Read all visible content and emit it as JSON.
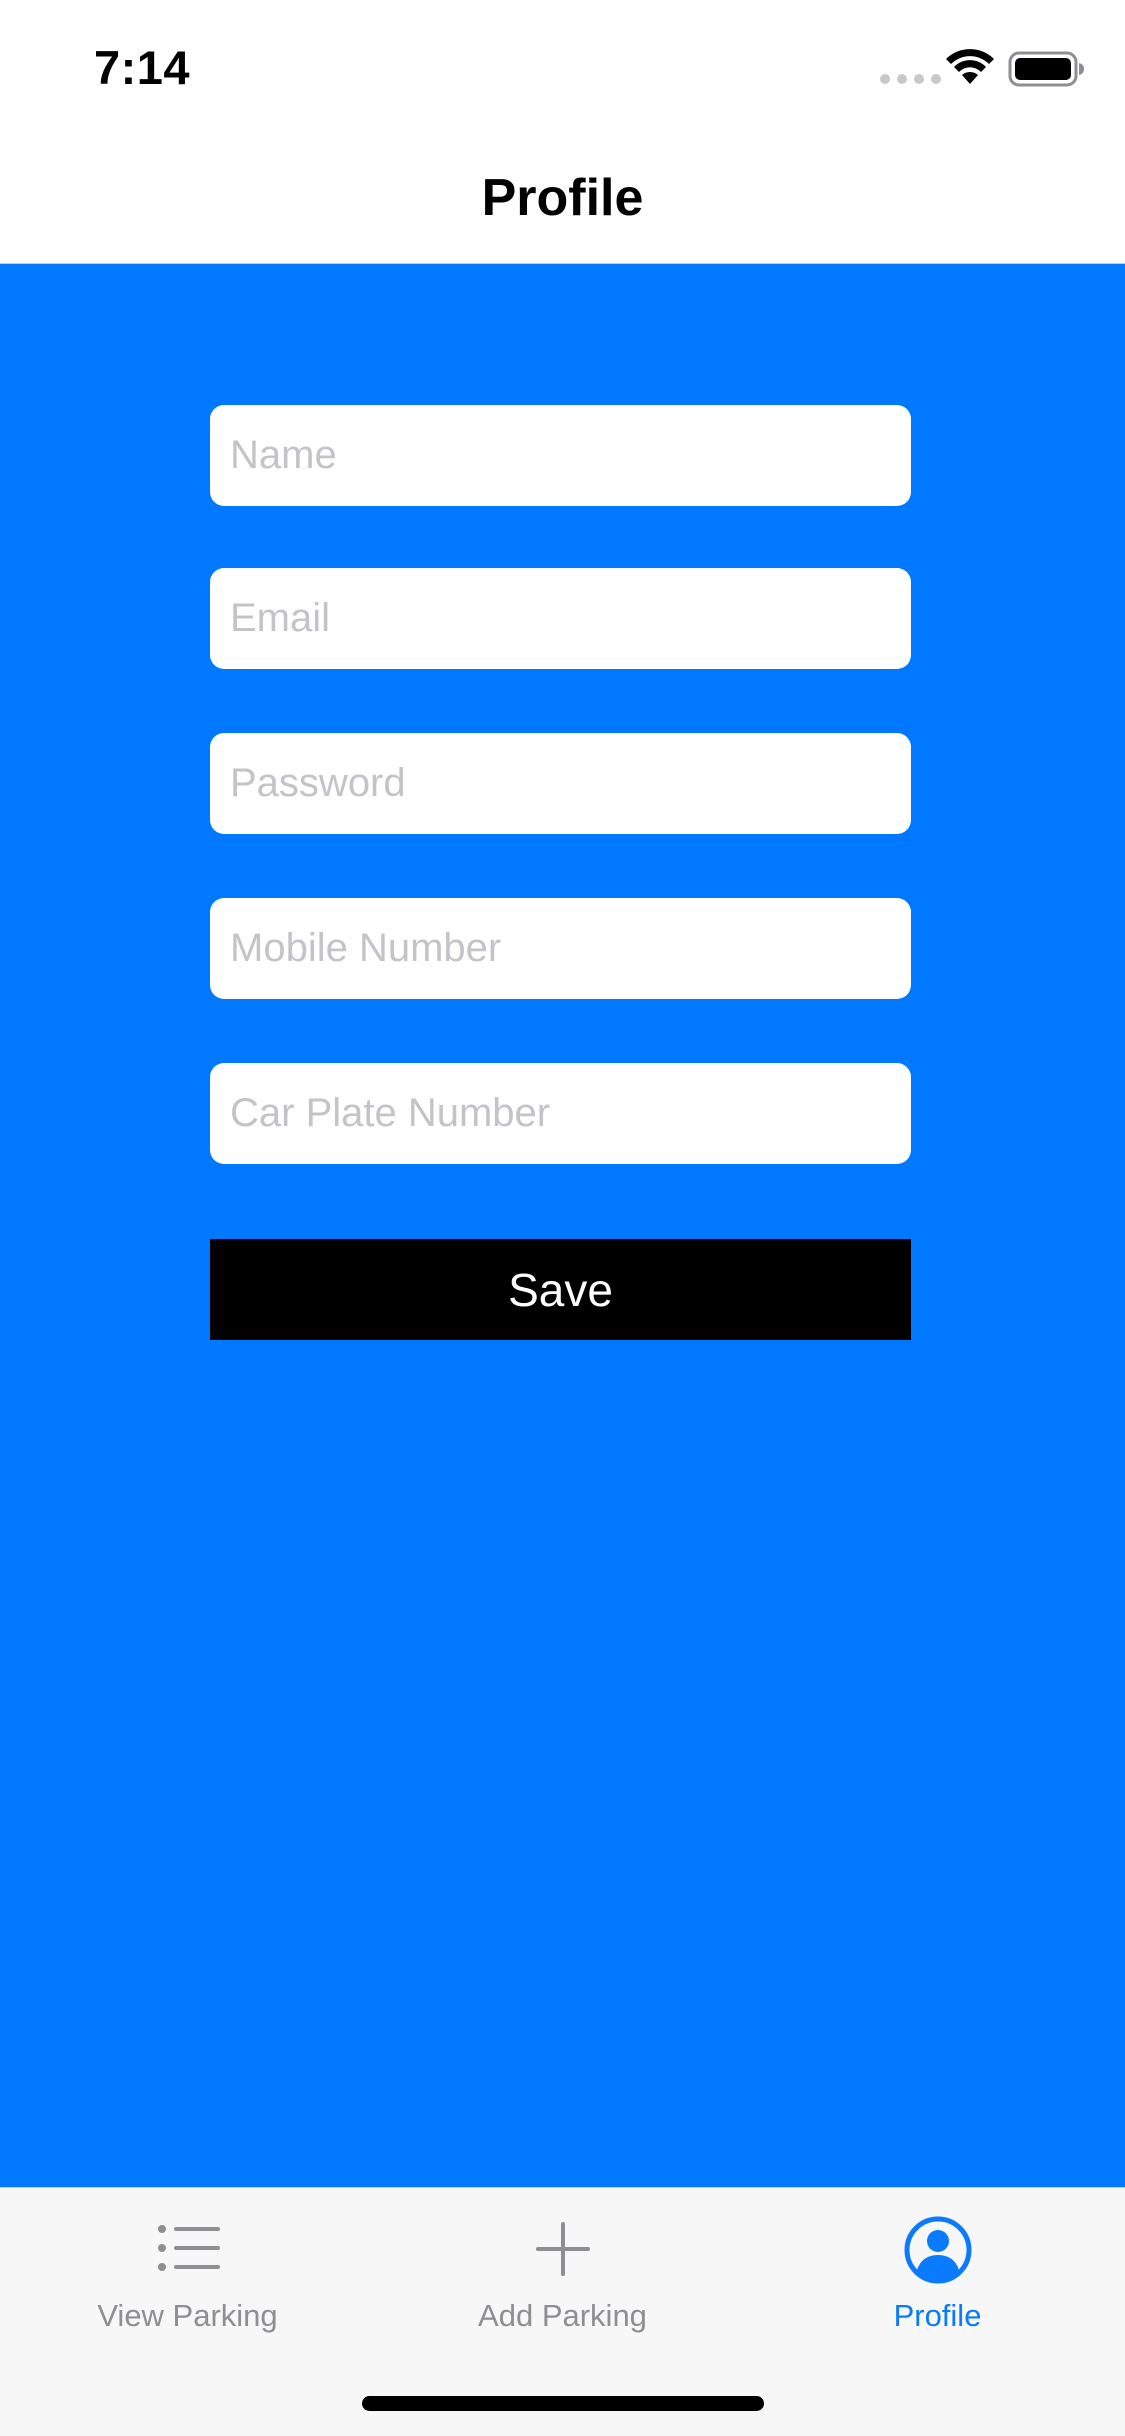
{
  "status_bar": {
    "time": "7:14"
  },
  "nav": {
    "title": "Profile"
  },
  "form": {
    "fields": [
      {
        "placeholder": "Name",
        "value": ""
      },
      {
        "placeholder": "Email",
        "value": ""
      },
      {
        "placeholder": "Password",
        "value": ""
      },
      {
        "placeholder": "Mobile Number",
        "value": ""
      },
      {
        "placeholder": "Car Plate Number",
        "value": ""
      }
    ],
    "save_label": "Save"
  },
  "tab_bar": {
    "items": [
      {
        "label": "View Parking",
        "icon": "list-icon",
        "active": false
      },
      {
        "label": "Add Parking",
        "icon": "plus-icon",
        "active": false
      },
      {
        "label": "Profile",
        "icon": "person-circle-icon",
        "active": true
      }
    ]
  },
  "colors": {
    "background": "#0078ff",
    "accent": "#0a7aff",
    "button": "#000000"
  }
}
